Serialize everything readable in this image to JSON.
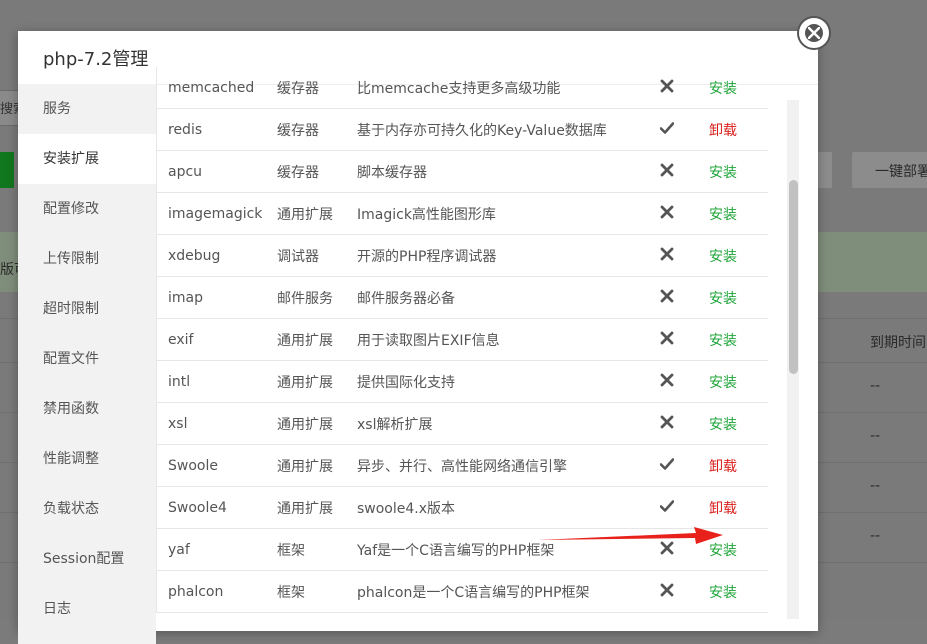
{
  "background": {
    "search_label": "搜索",
    "banner_text": "版可",
    "onekey_label": "一键部署",
    "expire_header": "到期时间",
    "expire_values": [
      "--",
      "--",
      "--",
      "--"
    ]
  },
  "modal": {
    "title": "php-7.2管理",
    "close_label": "×"
  },
  "sidebar": {
    "items": [
      {
        "label": "服务"
      },
      {
        "label": "安装扩展",
        "active": true
      },
      {
        "label": "配置修改"
      },
      {
        "label": "上传限制"
      },
      {
        "label": "超时限制"
      },
      {
        "label": "配置文件"
      },
      {
        "label": "禁用函数"
      },
      {
        "label": "性能调整"
      },
      {
        "label": "负载状态"
      },
      {
        "label": "Session配置"
      },
      {
        "label": "日志"
      }
    ]
  },
  "extensions": [
    {
      "name": "memcached",
      "type": "缓存器",
      "desc": "比memcache支持更多高级功能",
      "installed": false,
      "op": "安装"
    },
    {
      "name": "redis",
      "type": "缓存器",
      "desc": "基于内存亦可持久化的Key-Value数据库",
      "installed": true,
      "op": "卸载"
    },
    {
      "name": "apcu",
      "type": "缓存器",
      "desc": "脚本缓存器",
      "installed": false,
      "op": "安装"
    },
    {
      "name": "imagemagick",
      "type": "通用扩展",
      "desc": "Imagick高性能图形库",
      "installed": false,
      "op": "安装"
    },
    {
      "name": "xdebug",
      "type": "调试器",
      "desc": "开源的PHP程序调试器",
      "installed": false,
      "op": "安装"
    },
    {
      "name": "imap",
      "type": "邮件服务",
      "desc": "邮件服务器必备",
      "installed": false,
      "op": "安装"
    },
    {
      "name": "exif",
      "type": "通用扩展",
      "desc": "用于读取图片EXIF信息",
      "installed": false,
      "op": "安装"
    },
    {
      "name": "intl",
      "type": "通用扩展",
      "desc": "提供国际化支持",
      "installed": false,
      "op": "安装"
    },
    {
      "name": "xsl",
      "type": "通用扩展",
      "desc": "xsl解析扩展",
      "installed": false,
      "op": "安装"
    },
    {
      "name": "Swoole",
      "type": "通用扩展",
      "desc": "异步、并行、高性能网络通信引擎",
      "installed": true,
      "op": "卸载"
    },
    {
      "name": "Swoole4",
      "type": "通用扩展",
      "desc": "swoole4.x版本",
      "installed": true,
      "op": "卸载"
    },
    {
      "name": "yaf",
      "type": "框架",
      "desc": "Yaf是一个C语言编写的PHP框架",
      "installed": false,
      "op": "安装"
    },
    {
      "name": "phalcon",
      "type": "框架",
      "desc": "phalcon是一个C语言编写的PHP框架",
      "installed": false,
      "op": "安装"
    }
  ],
  "colors": {
    "install": "#20a53a",
    "uninstall": "#d9201c",
    "annotation_arrow": "#e8221b"
  },
  "icons": {
    "installed": "check-icon",
    "not_installed": "cross-icon"
  }
}
